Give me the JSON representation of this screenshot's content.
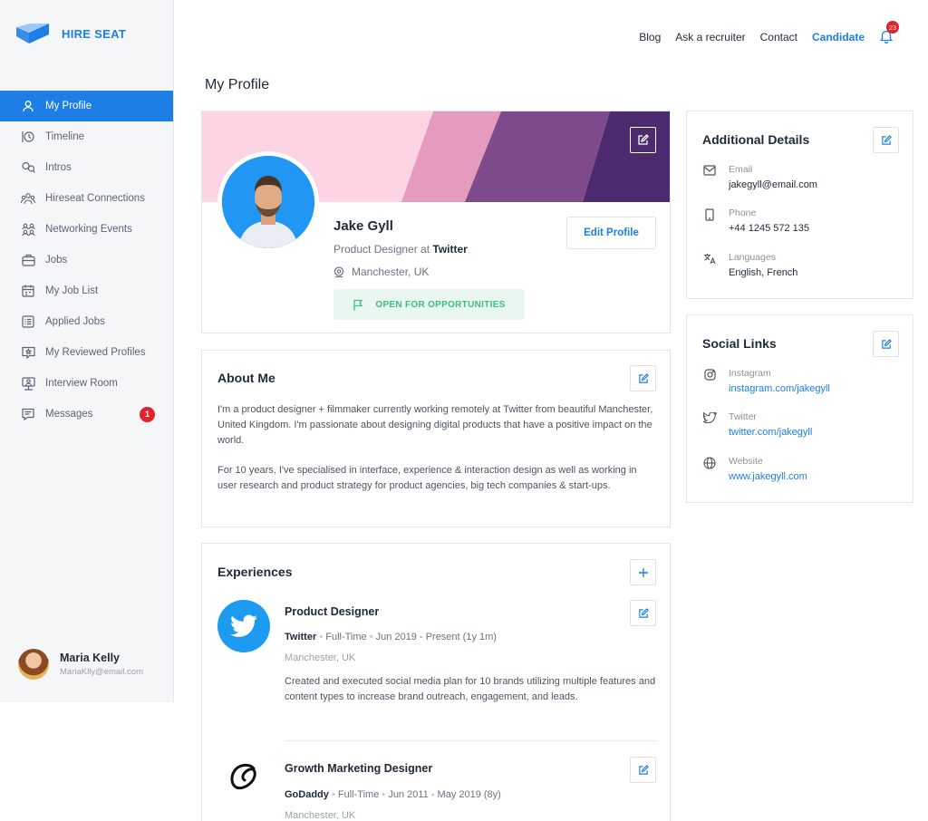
{
  "brand": {
    "name": "HIRE SEAT"
  },
  "topnav": {
    "items": [
      "Blog",
      "Ask a recruiter",
      "Contact"
    ],
    "active": "Candidate",
    "notifications": "23"
  },
  "sidebar": {
    "items": [
      {
        "label": "My Profile",
        "icon": "user-icon",
        "active": true
      },
      {
        "label": "Timeline",
        "icon": "timeline-icon"
      },
      {
        "label": "Intros",
        "icon": "intros-icon"
      },
      {
        "label": "Hireseat Connections",
        "icon": "connections-icon"
      },
      {
        "label": "Networking Events",
        "icon": "networking-icon"
      },
      {
        "label": "Jobs",
        "icon": "briefcase-icon"
      },
      {
        "label": "My Job List",
        "icon": "calendar-icon"
      },
      {
        "label": "Applied Jobs",
        "icon": "list-icon"
      },
      {
        "label": "My Reviewed Profiles",
        "icon": "reviewed-icon"
      },
      {
        "label": "Interview Room",
        "icon": "interview-icon"
      },
      {
        "label": "Messages",
        "icon": "message-icon",
        "badge": "1"
      }
    ],
    "user": {
      "name": "Maria Kelly",
      "email": "MariaKlly@email.com"
    }
  },
  "page": {
    "title": "My Profile"
  },
  "profile": {
    "name": "Jake Gyll",
    "role_prefix": "Product Designer at",
    "company": "Twitter",
    "location": "Manchester, UK",
    "status": "OPEN FOR OPPORTUNITIES",
    "edit_label": "Edit Profile"
  },
  "about": {
    "title": "About Me",
    "p1": "I'm a product designer + filmmaker currently working remotely at Twitter from beautiful Manchester, United Kingdom. I'm passionate about designing digital products that have a positive impact on the world.",
    "p2": "For 10 years, I've specialised in interface, experience & interaction design as well as working in user research and product strategy for product agencies, big tech companies & start-ups."
  },
  "experiences": {
    "title": "Experiences",
    "items": [
      {
        "title": "Product Designer",
        "company": "Twitter",
        "type": "Full-Time",
        "dates": "Jun 2019 - Present (1y 1m)",
        "place": "Manchester, UK",
        "desc": "Created and executed social media plan for 10 brands utilizing multiple features and content types to increase brand outreach, engagement, and leads."
      },
      {
        "title": "Growth Marketing Designer",
        "company": "GoDaddy",
        "type": "Full-Time",
        "dates": "Jun 2011 - May 2019 (8y)",
        "place": "Manchester, UK"
      }
    ]
  },
  "details": {
    "title": "Additional Details",
    "email_label": "Email",
    "email": "jakegyll@email.com",
    "phone_label": "Phone",
    "phone": "+44 1245 572 135",
    "lang_label": "Languages",
    "languages": "English, French"
  },
  "social": {
    "title": "Social Links",
    "instagram_label": "Instagram",
    "instagram": "instagram.com/jakegyll",
    "twitter_label": "Twitter",
    "twitter": "twitter.com/jakegyll",
    "website_label": "Website",
    "website": "www.jakegyll.com"
  },
  "colors": {
    "accent": "#1d7fe6",
    "open": "#3cbf7f",
    "badge": "#e5212b",
    "banner_pink": "#fcd4e3",
    "banner_purple": "#4b2a6e"
  }
}
